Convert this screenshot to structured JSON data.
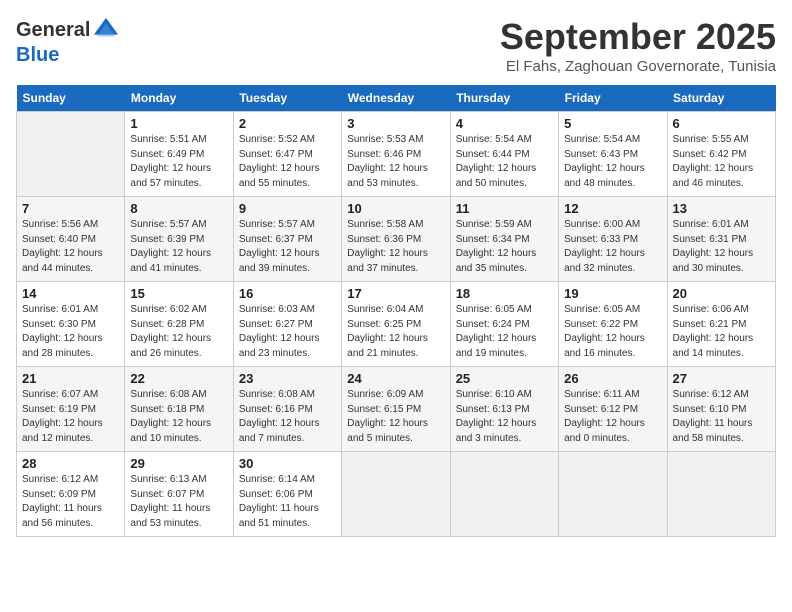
{
  "header": {
    "logo_general": "General",
    "logo_blue": "Blue",
    "month_title": "September 2025",
    "subtitle": "El Fahs, Zaghouan Governorate, Tunisia"
  },
  "calendar": {
    "days_of_week": [
      "Sunday",
      "Monday",
      "Tuesday",
      "Wednesday",
      "Thursday",
      "Friday",
      "Saturday"
    ],
    "weeks": [
      [
        {
          "day": "",
          "content": ""
        },
        {
          "day": "1",
          "content": "Sunrise: 5:51 AM\nSunset: 6:49 PM\nDaylight: 12 hours\nand 57 minutes."
        },
        {
          "day": "2",
          "content": "Sunrise: 5:52 AM\nSunset: 6:47 PM\nDaylight: 12 hours\nand 55 minutes."
        },
        {
          "day": "3",
          "content": "Sunrise: 5:53 AM\nSunset: 6:46 PM\nDaylight: 12 hours\nand 53 minutes."
        },
        {
          "day": "4",
          "content": "Sunrise: 5:54 AM\nSunset: 6:44 PM\nDaylight: 12 hours\nand 50 minutes."
        },
        {
          "day": "5",
          "content": "Sunrise: 5:54 AM\nSunset: 6:43 PM\nDaylight: 12 hours\nand 48 minutes."
        },
        {
          "day": "6",
          "content": "Sunrise: 5:55 AM\nSunset: 6:42 PM\nDaylight: 12 hours\nand 46 minutes."
        }
      ],
      [
        {
          "day": "7",
          "content": "Sunrise: 5:56 AM\nSunset: 6:40 PM\nDaylight: 12 hours\nand 44 minutes."
        },
        {
          "day": "8",
          "content": "Sunrise: 5:57 AM\nSunset: 6:39 PM\nDaylight: 12 hours\nand 41 minutes."
        },
        {
          "day": "9",
          "content": "Sunrise: 5:57 AM\nSunset: 6:37 PM\nDaylight: 12 hours\nand 39 minutes."
        },
        {
          "day": "10",
          "content": "Sunrise: 5:58 AM\nSunset: 6:36 PM\nDaylight: 12 hours\nand 37 minutes."
        },
        {
          "day": "11",
          "content": "Sunrise: 5:59 AM\nSunset: 6:34 PM\nDaylight: 12 hours\nand 35 minutes."
        },
        {
          "day": "12",
          "content": "Sunrise: 6:00 AM\nSunset: 6:33 PM\nDaylight: 12 hours\nand 32 minutes."
        },
        {
          "day": "13",
          "content": "Sunrise: 6:01 AM\nSunset: 6:31 PM\nDaylight: 12 hours\nand 30 minutes."
        }
      ],
      [
        {
          "day": "14",
          "content": "Sunrise: 6:01 AM\nSunset: 6:30 PM\nDaylight: 12 hours\nand 28 minutes."
        },
        {
          "day": "15",
          "content": "Sunrise: 6:02 AM\nSunset: 6:28 PM\nDaylight: 12 hours\nand 26 minutes."
        },
        {
          "day": "16",
          "content": "Sunrise: 6:03 AM\nSunset: 6:27 PM\nDaylight: 12 hours\nand 23 minutes."
        },
        {
          "day": "17",
          "content": "Sunrise: 6:04 AM\nSunset: 6:25 PM\nDaylight: 12 hours\nand 21 minutes."
        },
        {
          "day": "18",
          "content": "Sunrise: 6:05 AM\nSunset: 6:24 PM\nDaylight: 12 hours\nand 19 minutes."
        },
        {
          "day": "19",
          "content": "Sunrise: 6:05 AM\nSunset: 6:22 PM\nDaylight: 12 hours\nand 16 minutes."
        },
        {
          "day": "20",
          "content": "Sunrise: 6:06 AM\nSunset: 6:21 PM\nDaylight: 12 hours\nand 14 minutes."
        }
      ],
      [
        {
          "day": "21",
          "content": "Sunrise: 6:07 AM\nSunset: 6:19 PM\nDaylight: 12 hours\nand 12 minutes."
        },
        {
          "day": "22",
          "content": "Sunrise: 6:08 AM\nSunset: 6:18 PM\nDaylight: 12 hours\nand 10 minutes."
        },
        {
          "day": "23",
          "content": "Sunrise: 6:08 AM\nSunset: 6:16 PM\nDaylight: 12 hours\nand 7 minutes."
        },
        {
          "day": "24",
          "content": "Sunrise: 6:09 AM\nSunset: 6:15 PM\nDaylight: 12 hours\nand 5 minutes."
        },
        {
          "day": "25",
          "content": "Sunrise: 6:10 AM\nSunset: 6:13 PM\nDaylight: 12 hours\nand 3 minutes."
        },
        {
          "day": "26",
          "content": "Sunrise: 6:11 AM\nSunset: 6:12 PM\nDaylight: 12 hours\nand 0 minutes."
        },
        {
          "day": "27",
          "content": "Sunrise: 6:12 AM\nSunset: 6:10 PM\nDaylight: 11 hours\nand 58 minutes."
        }
      ],
      [
        {
          "day": "28",
          "content": "Sunrise: 6:12 AM\nSunset: 6:09 PM\nDaylight: 11 hours\nand 56 minutes."
        },
        {
          "day": "29",
          "content": "Sunrise: 6:13 AM\nSunset: 6:07 PM\nDaylight: 11 hours\nand 53 minutes."
        },
        {
          "day": "30",
          "content": "Sunrise: 6:14 AM\nSunset: 6:06 PM\nDaylight: 11 hours\nand 51 minutes."
        },
        {
          "day": "",
          "content": ""
        },
        {
          "day": "",
          "content": ""
        },
        {
          "day": "",
          "content": ""
        },
        {
          "day": "",
          "content": ""
        }
      ]
    ]
  }
}
